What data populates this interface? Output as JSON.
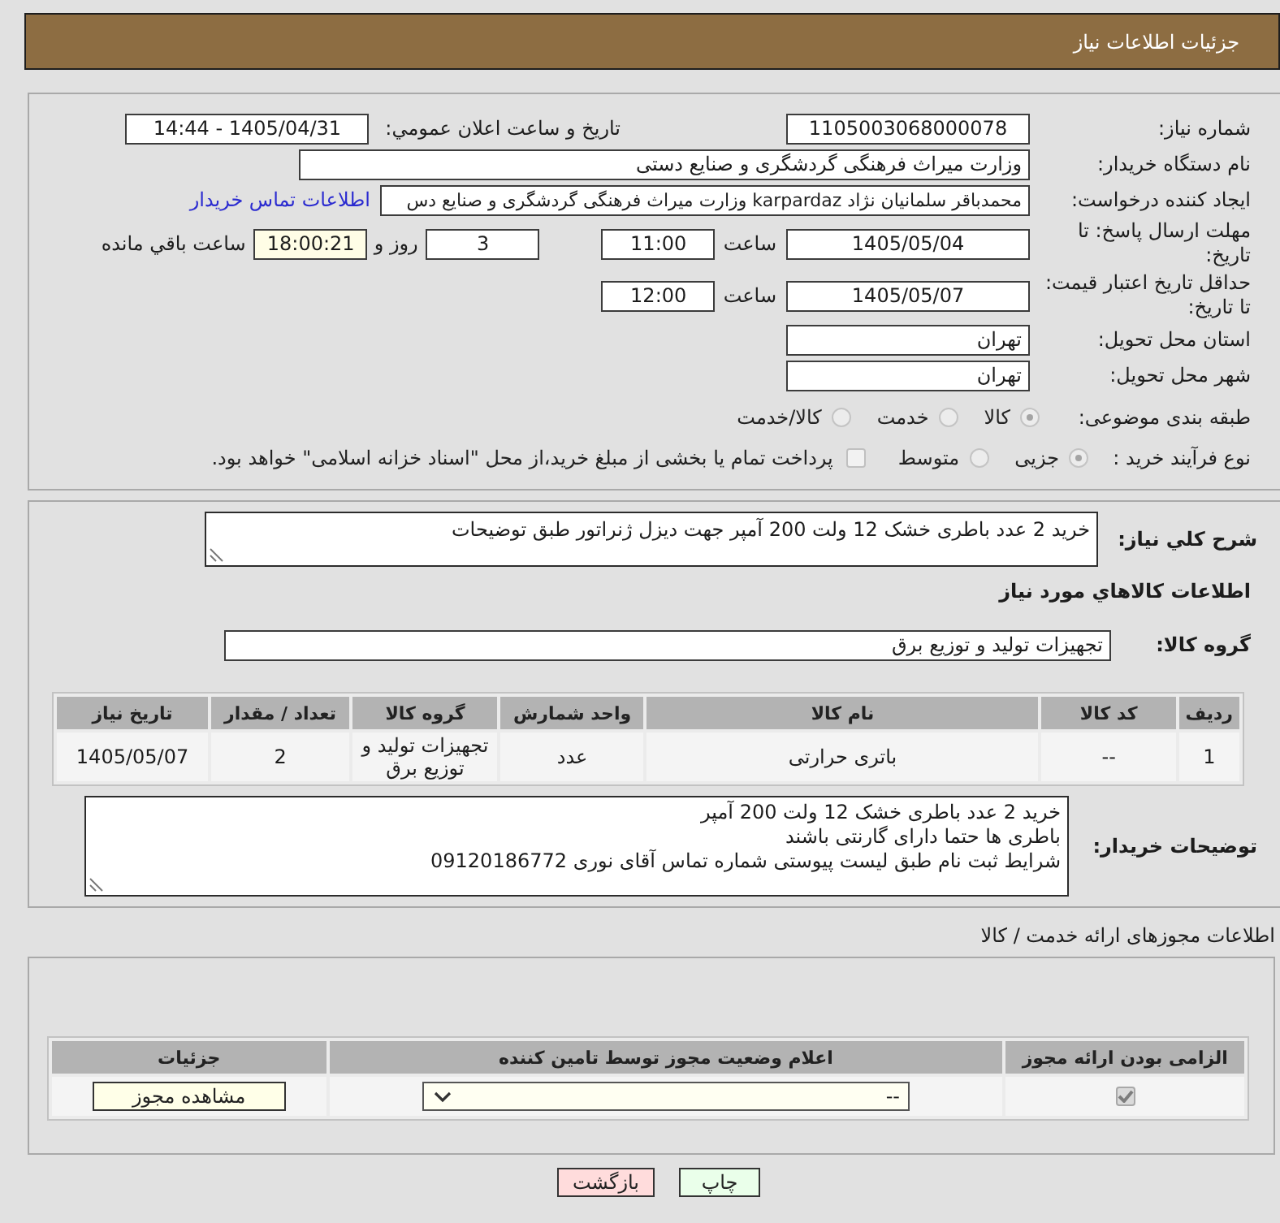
{
  "header": {
    "title": "جزئیات اطلاعات نیاز"
  },
  "need_info": {
    "need_number": {
      "label": "شماره نیاز:",
      "value": "1105003068000078"
    },
    "announce_datetime": {
      "label": "تاریخ و ساعت اعلان عمومي:",
      "value": "1405/04/31 - 14:44"
    },
    "buyer_org": {
      "label": "نام دستگاه خریدار:",
      "value": "وزارت میراث فرهنگی  گردشگری و صنایع دستی"
    },
    "requester": {
      "label": "ایجاد کننده درخواست:",
      "value": "محمدباقر سلمانیان نژاد karpardaz وزارت میراث فرهنگی  گردشگری و صنایع دس",
      "link": "اطلاعات تماس خریدار"
    },
    "reply_deadline": {
      "label": "مهلت ارسال پاسخ: تا تاریخ:",
      "date": "1405/05/04",
      "time_label": "ساعت",
      "time": "11:00",
      "days": "3",
      "days_label": "روز و",
      "remaining": "18:00:21",
      "remaining_label": "ساعت باقي مانده"
    },
    "price_validity": {
      "label": "حداقل تاریخ اعتبار قیمت: تا تاریخ:",
      "date": "1405/05/07",
      "time_label": "ساعت",
      "time": "12:00"
    },
    "delivery_province": {
      "label": "استان محل تحویل:",
      "value": "تهران"
    },
    "delivery_city": {
      "label": "شهر محل تحویل:",
      "value": "تهران"
    },
    "category": {
      "label": "طبقه بندی موضوعی:",
      "options": [
        {
          "label": "کالا",
          "selected": true
        },
        {
          "label": "خدمت",
          "selected": false
        },
        {
          "label": "کالا/خدمت",
          "selected": false
        }
      ]
    },
    "purchase_type": {
      "label": "نوع فرآیند خرید :",
      "options": [
        {
          "label": "جزیی",
          "selected": true
        },
        {
          "label": "متوسط",
          "selected": false
        }
      ],
      "treasury": {
        "label": "پرداخت تمام یا بخشی از مبلغ خرید،از محل \"اسناد خزانه اسلامی\" خواهد بود.",
        "checked": false
      }
    }
  },
  "goods": {
    "description": {
      "label": "شرح کلي نياز:",
      "value": "خرید 2 عدد باطری خشک 12 ولت 200 آمپر جهت دیزل ژنراتور  طبق توضیحات"
    },
    "title": "اطلاعات کالاهاي مورد نياز",
    "group": {
      "label": "گروه کالا:",
      "value": "تجهیزات تولید و توزیع برق"
    },
    "table": {
      "columns": [
        "ردیف",
        "کد کالا",
        "نام کالا",
        "واحد شمارش",
        "گروه کالا",
        "تعداد / مقدار",
        "تاریخ نیاز"
      ],
      "rows": [
        [
          "1",
          "--",
          "باتری حرارتی",
          "عدد",
          "تجهیزات تولید و توزیع برق",
          "2",
          "1405/05/07"
        ]
      ]
    },
    "buyer_notes": {
      "label": "توضیحات خریدار:",
      "lines": [
        "خرید 2 عدد باطری خشک 12 ولت 200 آمپر",
        "باطری ها حتما دارای گارنتی باشند",
        "شرایط ثبت نام طبق لیست پیوستی شماره تماس آقای نوری 09120186772"
      ]
    }
  },
  "permits": {
    "title": "اطلاعات مجوزهای ارائه خدمت / کالا",
    "columns": [
      "الزامی بودن ارائه مجوز",
      "اعلام وضعیت مجوز توسط تامین کننده",
      "جزئیات"
    ],
    "rows": [
      {
        "required": true,
        "status": "--",
        "action": "مشاهده مجوز"
      }
    ]
  },
  "buttons": [
    {
      "label": "چاپ",
      "kind": "print"
    },
    {
      "label": "بازگشت",
      "kind": "back"
    }
  ]
}
